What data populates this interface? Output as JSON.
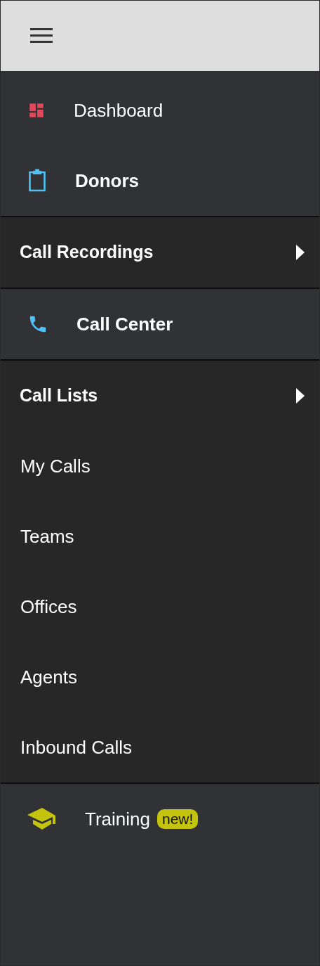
{
  "menu": [
    {
      "kind": "dashboard",
      "label": "Dashboard",
      "active": false
    },
    {
      "kind": "clipboard",
      "label": "Donors",
      "active": true
    },
    {
      "kind": "group",
      "label": "Call Recordings"
    },
    {
      "kind": "phone",
      "label": "Call Center",
      "active": true
    },
    {
      "kind": "group",
      "label": "Call Lists",
      "children": [
        {
          "label": "My Calls"
        },
        {
          "label": "Teams"
        },
        {
          "label": "Offices"
        },
        {
          "label": "Agents"
        },
        {
          "label": "Inbound Calls"
        }
      ]
    },
    {
      "kind": "training",
      "label": "Training",
      "active": false,
      "badge": "new!"
    }
  ]
}
